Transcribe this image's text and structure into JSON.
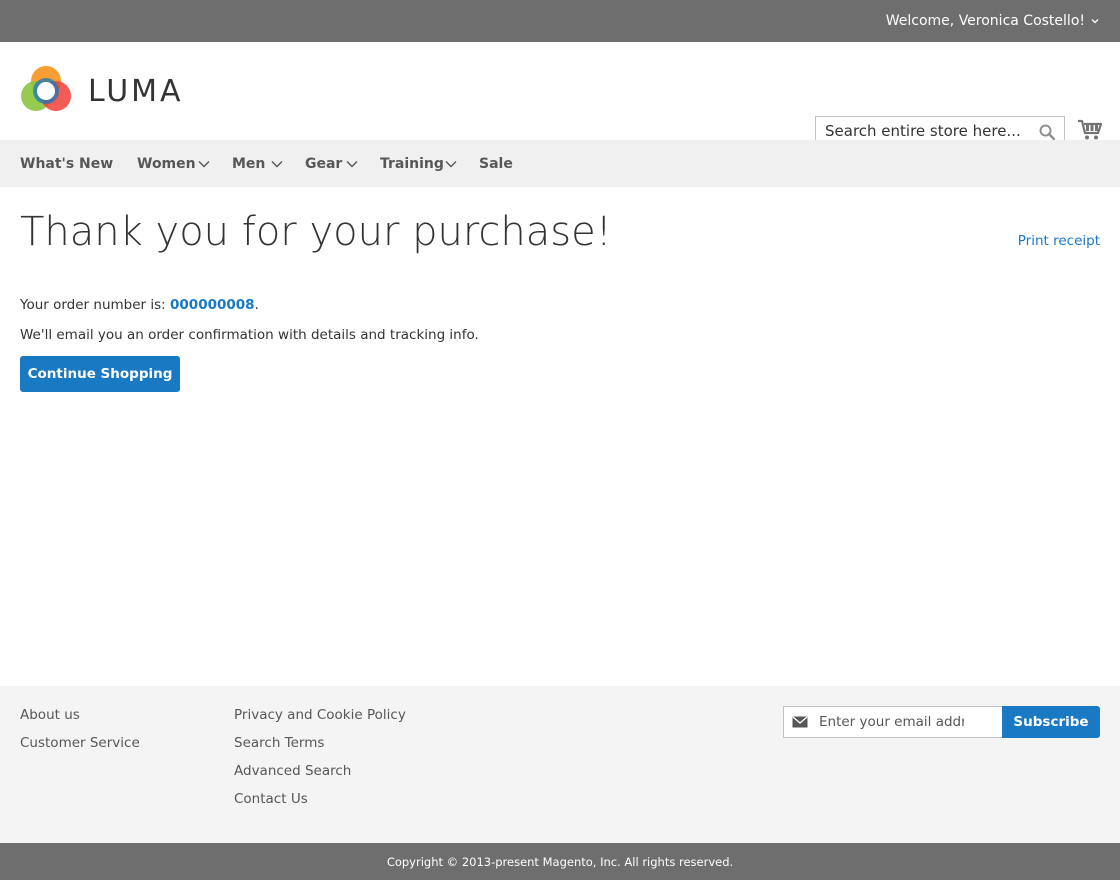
{
  "header": {
    "welcome_text": "Welcome, Veronica Costello!",
    "logo_text": "LUMA",
    "search_placeholder": "Search entire store here...",
    "search_button_label": "Search",
    "cart_label": "My Cart"
  },
  "nav": {
    "items": [
      {
        "label": "What's New",
        "has_dropdown": false
      },
      {
        "label": "Women",
        "has_dropdown": true
      },
      {
        "label": "Men",
        "has_dropdown": true
      },
      {
        "label": "Gear",
        "has_dropdown": true
      },
      {
        "label": "Training",
        "has_dropdown": true
      },
      {
        "label": "Sale",
        "has_dropdown": false
      }
    ]
  },
  "main": {
    "title": "Thank you for your purchase!",
    "print_receipt": "Print receipt",
    "order_prefix": "Your order number is: ",
    "order_number": "000000008",
    "order_suffix": ".",
    "email_notice": "We'll email you an order confirmation with details and tracking info.",
    "continue_button": "Continue Shopping"
  },
  "footer": {
    "col1": [
      "About us",
      "Customer Service"
    ],
    "col2": [
      "Privacy and Cookie Policy",
      "Search Terms",
      "Advanced Search",
      "Contact Us"
    ],
    "newsletter_placeholder": "Enter your email address",
    "subscribe_label": "Subscribe",
    "copyright": "Copyright © 2013-present Magento, Inc. All rights reserved."
  },
  "colors": {
    "accent": "#1979c3",
    "header_bg": "#6e6e6e",
    "nav_bg": "#f0f0f0",
    "footer_bg": "#f4f4f4"
  },
  "icons": [
    "chevron-down-icon",
    "search-icon",
    "cart-icon",
    "mail-icon",
    "luma-logo-icon"
  ]
}
